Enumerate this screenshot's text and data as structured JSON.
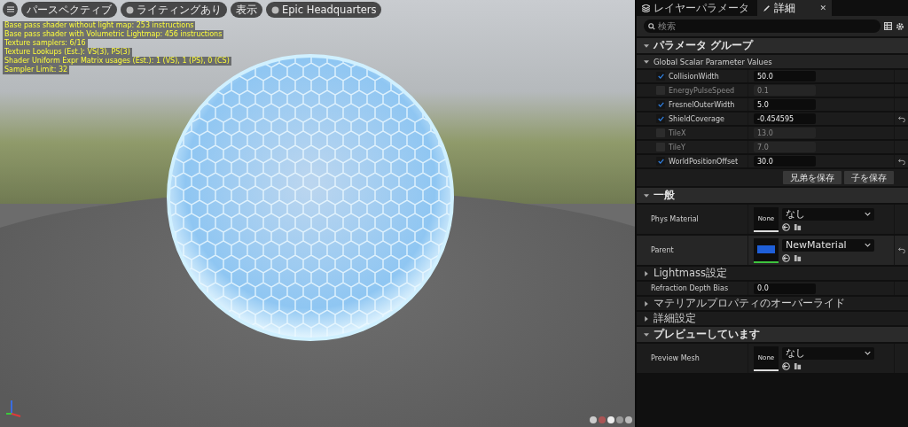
{
  "viewport": {
    "toolbar": [
      {
        "kind": "menu"
      },
      {
        "kind": "button",
        "label": "パースペクティブ",
        "icon": false
      },
      {
        "kind": "button",
        "label": "ライティングあり",
        "icon": true
      },
      {
        "kind": "button",
        "label": "表示",
        "icon": false
      },
      {
        "kind": "button",
        "label": "Epic Headquarters",
        "icon": true
      }
    ],
    "stats": [
      "Base pass shader without light map: 253 instructions",
      "Base pass shader with Volumetric Lightmap: 456 instructions",
      "Texture samplers: 6/16",
      "Texture Lookups (Est.): VS(3), PS(3)",
      "Shader Uniform Expr Matrix usages (Est.): 1 (VS), 1 (PS), 0 (CS)",
      "Sampler Limit: 32"
    ]
  },
  "panel": {
    "tabs": [
      {
        "label": "レイヤーパラメータ",
        "selected": false,
        "kind": "layers"
      },
      {
        "label": "詳細",
        "selected": true,
        "kind": "details",
        "close": "✕"
      }
    ],
    "search": {
      "placeholder": "検索"
    },
    "sections": [
      {
        "kind": "header",
        "label": "パラメータ グループ",
        "expanded": true
      },
      {
        "kind": "subheader",
        "label": "Global Scalar Parameter Values",
        "expanded": true
      },
      {
        "kind": "param",
        "label": "CollisionWidth",
        "checked": true,
        "value": "50.0",
        "revert": false
      },
      {
        "kind": "param",
        "label": "EnergyPulseSpeed",
        "checked": false,
        "value": "0.1",
        "revert": false
      },
      {
        "kind": "param",
        "label": "FresnelOuterWidth",
        "checked": true,
        "value": "5.0",
        "revert": false
      },
      {
        "kind": "param",
        "label": "ShieldCoverage",
        "checked": true,
        "value": "-0.454595",
        "revert": true
      },
      {
        "kind": "param",
        "label": "TileX",
        "checked": false,
        "value": "13.0",
        "revert": false
      },
      {
        "kind": "param",
        "label": "TileY",
        "checked": false,
        "value": "7.0",
        "revert": false
      },
      {
        "kind": "param",
        "label": "WorldPositionOffset",
        "checked": true,
        "value": "30.0",
        "revert": true
      },
      {
        "kind": "buttons",
        "buttons": [
          "兄弟を保存",
          "子を保存"
        ]
      },
      {
        "kind": "header",
        "label": "一般",
        "expanded": true
      },
      {
        "kind": "asset",
        "label": "Phys Material",
        "thumb": "None",
        "value": "なし",
        "revert": false
      },
      {
        "kind": "asset",
        "label": "Parent",
        "value": "NewMaterial",
        "revert": true
      },
      {
        "kind": "group",
        "label": "Lightmass設定",
        "expanded": false
      },
      {
        "kind": "field",
        "label": "Refraction Depth Bias",
        "value": "0.0"
      },
      {
        "kind": "group",
        "label": "マテリアルプロパティのオーバーライド",
        "expanded": false
      },
      {
        "kind": "group",
        "label": "詳細設定",
        "expanded": false
      },
      {
        "kind": "header",
        "label": "プレビューしています",
        "expanded": true
      },
      {
        "kind": "asset",
        "label": "Preview Mesh",
        "thumb": "None",
        "value": "なし",
        "revert": false
      }
    ]
  }
}
